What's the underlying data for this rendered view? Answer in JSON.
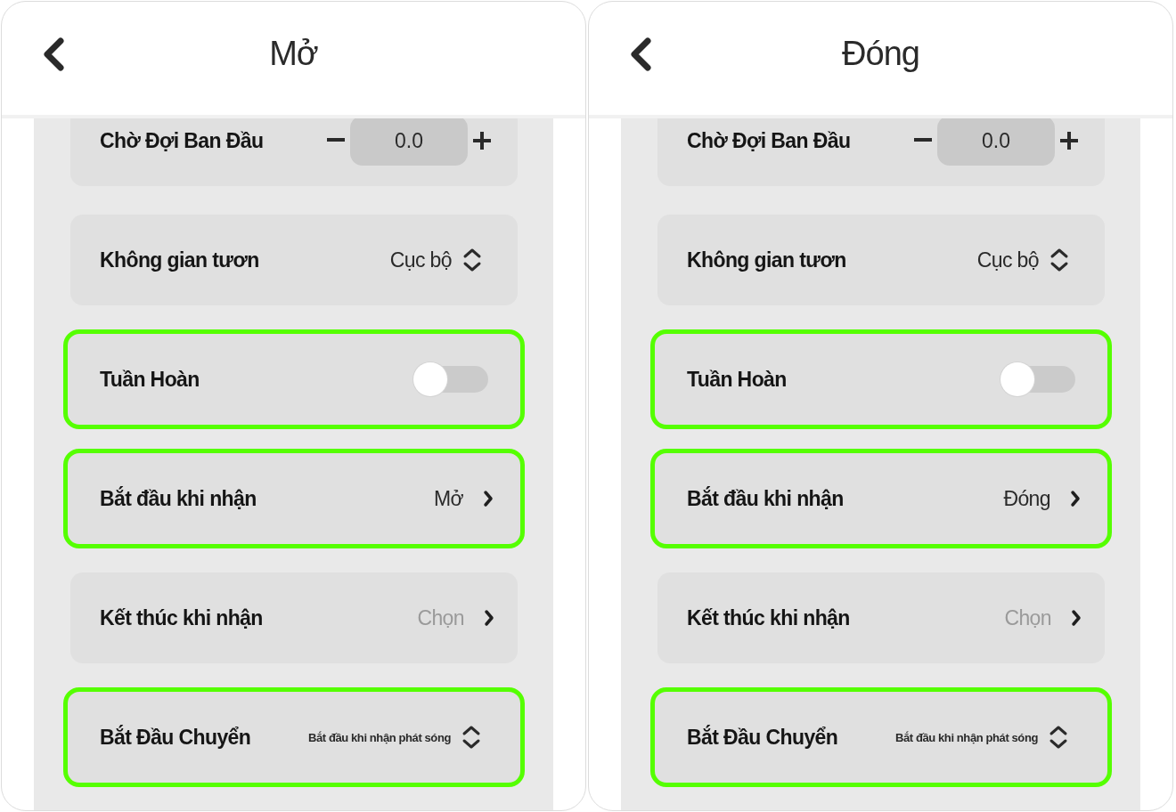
{
  "panels": [
    {
      "title": "Mở",
      "rows": [
        {
          "kind": "stepper",
          "label": "Chờ Đợi Ban Đầu",
          "value": "0.0",
          "highlighted": false
        },
        {
          "kind": "select",
          "label": "Không gian tươn",
          "value": "Cục bộ",
          "compact": false,
          "highlighted": false
        },
        {
          "kind": "toggle",
          "label": "Tuần Hoàn",
          "on": false,
          "highlighted": true
        },
        {
          "kind": "link",
          "label": "Bắt đầu khi nhận",
          "value": "Mở",
          "muted": false,
          "highlighted": true
        },
        {
          "kind": "link",
          "label": "Kết thúc khi nhận",
          "value": "Chọn",
          "muted": true,
          "highlighted": false
        },
        {
          "kind": "select",
          "label": "Bắt Đầu Chuyển",
          "value": "Bắt đầu khi nhận phát sóng",
          "compact": true,
          "highlighted": true
        }
      ]
    },
    {
      "title": "Đóng",
      "rows": [
        {
          "kind": "stepper",
          "label": "Chờ Đợi Ban Đầu",
          "value": "0.0",
          "highlighted": false
        },
        {
          "kind": "select",
          "label": "Không gian tươn",
          "value": "Cục bộ",
          "compact": false,
          "highlighted": false
        },
        {
          "kind": "toggle",
          "label": "Tuần Hoàn",
          "on": false,
          "highlighted": true
        },
        {
          "kind": "link",
          "label": "Bắt đầu khi nhận",
          "value": "Đóng",
          "muted": false,
          "highlighted": true
        },
        {
          "kind": "link",
          "label": "Kết thúc khi nhận",
          "value": "Chọn",
          "muted": true,
          "highlighted": false
        },
        {
          "kind": "select",
          "label": "Bắt Đầu Chuyển",
          "value": "Bắt đầu khi nhận phát sóng",
          "compact": true,
          "highlighted": true
        }
      ]
    }
  ]
}
